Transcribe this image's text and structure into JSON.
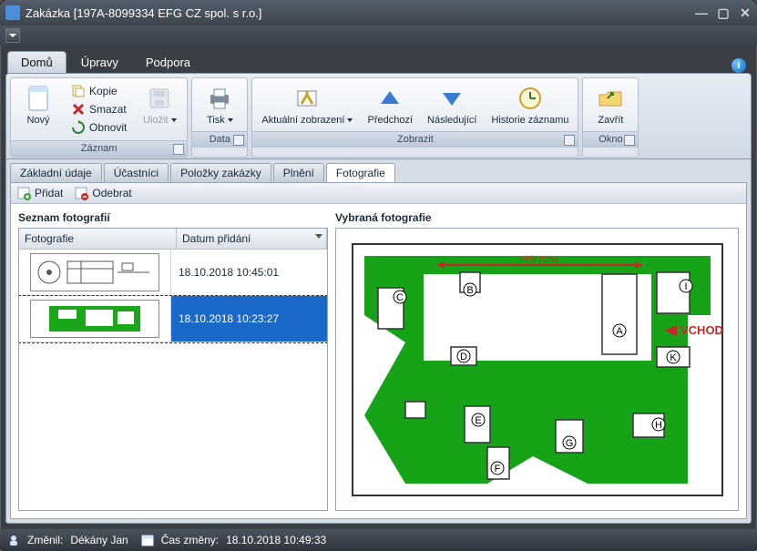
{
  "window": {
    "title": "Zakázka [197A-8099334 EFG CZ spol. s r.o.]"
  },
  "menu": {
    "tabs": [
      "Domů",
      "Úpravy",
      "Podpora"
    ],
    "activeIndex": 0
  },
  "ribbon": {
    "groups": {
      "zaznam": {
        "label": "Záznam",
        "novy": "Nový",
        "kopie": "Kopie",
        "smazat": "Smazat",
        "obnovit": "Obnovit",
        "ulozit": "Uložit"
      },
      "data": {
        "label": "Data",
        "tisk": "Tisk"
      },
      "zobrazit": {
        "label": "Zobrazit",
        "aktualni": "Aktuální zobrazení",
        "predchozi": "Předchozí",
        "nasledujici": "Následující",
        "historie": "Historie záznamu"
      },
      "okno": {
        "label": "Okno",
        "zavrit": "Zavřít"
      }
    }
  },
  "viewTabs": {
    "items": [
      "Základní údaje",
      "Účastníci",
      "Položky zakázky",
      "Plnění",
      "Fotografie"
    ],
    "activeIndex": 4
  },
  "toolbar2": {
    "pridat": "Přidat",
    "odebrat": "Odebrat"
  },
  "photos": {
    "list_title": "Seznam fotografií",
    "preview_title": "Vybraná fotografie",
    "columns": {
      "foto": "Fotografie",
      "date": "Datum přidání"
    },
    "rows": [
      {
        "date": "18.10.2018 10:45:01",
        "selected": false
      },
      {
        "date": "18.10.2018 10:23:27",
        "selected": true
      }
    ]
  },
  "preview_map": {
    "pesizona": "PĚŠÍ ZÓNA",
    "vchod": "VCHOD",
    "labels": {
      "A": "A",
      "B": "B",
      "C": "C",
      "D": "D",
      "E": "E",
      "F": "F",
      "G": "G",
      "H": "H",
      "I": "I",
      "K": "K"
    }
  },
  "status": {
    "zmenil_label": "Změnil:",
    "zmenil_value": "Dékány Jan",
    "cas_label": "Čas změny:",
    "cas_value": "18.10.2018 10:49:33"
  }
}
